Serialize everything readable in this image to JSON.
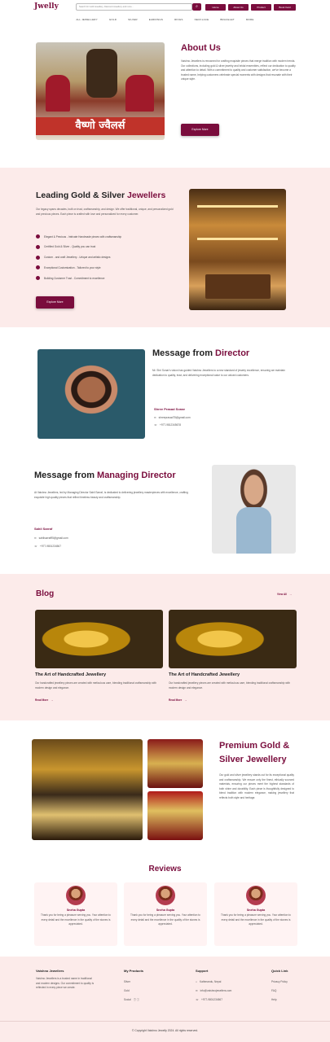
{
  "header": {
    "logo": "Jwelly",
    "search_placeholder": "Search for Gold Jewellery, Diamond Jewellery and more...",
    "nav": [
      "Home",
      "About Us",
      "Product",
      "Book Card"
    ]
  },
  "categories": [
    "ALL JEWELLERY",
    "GOLD",
    "SILVER",
    "EARRINGS",
    "RINGS",
    "NECKLACE",
    "BRACELET",
    "MORE"
  ],
  "about": {
    "title": "About Us",
    "text": "Vaishno Jewellers is renowned for crafting exquisite pieces that merge tradition with modern trends. Our collections, including gold & silver jewelry and bridal ensembles, reflect our dedication to quality and attention to detail. With a commitment to quality and customer satisfaction, we've become a trusted name, helping customers celebrate special moments with designs that resonate with their unique style.",
    "button": "Explore More",
    "shop_sign": "वैष्णो ज्वैलर्स"
  },
  "leading": {
    "title_plain": "Leading Gold & Silver ",
    "title_accent": "Jewellers",
    "text": "Our legacy spans decades, built on trust, craftsmanship, and design. We offer traditional, unique, and personalized gold and precious pieces. Each piece is crafted with love and personalized for every customer.",
    "features": [
      "Elegant & Precious - Intricate Handmade pieces with craftsmanship",
      "Certified Gold & Silver - Quality you can trust",
      "Custom - and craft Jewellery - Unique and artistic designs",
      "Exceptional Customization - Tailored to your style",
      "Building Customer Trust - Commitment to excellence"
    ],
    "button": "Explore More"
  },
  "director": {
    "title_plain": "Message from ",
    "title_accent": "Director",
    "text": "Mr. Shri Sonar's vision has guided Vaishno Jewellers to a new standard of jewelry excellence, ensuring we maintain dedication to quality, trust, and delivering exceptional value to our valued customers.",
    "name": "Shree Prasad Sonar",
    "email": "shreeprasad75@gmail.com",
    "phone": "+977-9812345678"
  },
  "md": {
    "title_plain": "Message from ",
    "title_accent": "Managing Director",
    "text": "At Vaishno Jewellers, led by Managing Director Sahil Sarraf, is dedicated to delivering jewellery masterpieces with excellence, crafting exquisite high quality pieces that reflect timeless beauty and craftsmanship.",
    "name": "Sahil Sarraf",
    "email": "sahilsarraf95@gmail.com",
    "phone": "+977-9801234567"
  },
  "blog": {
    "title": "Blog",
    "view_all": "View All",
    "posts": [
      {
        "title": "The Art of Handcrafted Jewellery",
        "text": "Our handcrafted jewellery pieces are created with meticulous care, blending traditional craftsmanship with modern design and elegance.",
        "link": "Read More"
      },
      {
        "title": "The Art of Handcrafted Jewellery",
        "text": "Our handcrafted jewellery pieces are created with meticulous care, blending traditional craftsmanship with modern design and elegance.",
        "link": "Read More"
      }
    ]
  },
  "premium": {
    "title": "Premium Gold & Silver Jewellery",
    "text": "Our gold and silver jewellery stands out for its exceptional quality and craftsmanship. We ensure only the finest, ethically sourced materials, ensuring our pieces meet the highest standards of both shine and durability. Each piece is thoughtfully designed to blend tradition with modern elegance, making jewellery that reflects both style and heritage."
  },
  "reviews": {
    "title": "Reviews",
    "items": [
      {
        "name": "Sneha Gupta",
        "text": "Thank you for being a pleasure serving you. Your attention to every detail and the excellence in the quality of the stones is appreciated."
      },
      {
        "name": "Sneha Gupta",
        "text": "Thank you for being a pleasure serving you. Your attention to every detail and the excellence in the quality of the stones is appreciated."
      },
      {
        "name": "Sneha Gupta",
        "text": "Thank you for being a pleasure serving you. Your attention to every detail and the excellence in the quality of the stones is appreciated."
      }
    ]
  },
  "footer": {
    "brand": "Vaishno Jewellers",
    "about": "Vaishno Jewellers is a trusted name in traditional and modern designs. Our commitment to quality is reflected in every piece we create.",
    "products_title": "My Products",
    "products": [
      "Silver",
      "Gold",
      "Social"
    ],
    "support_title": "Support",
    "support": [
      "Kathmandu, Nepal",
      "info@vaishnojewellers.com",
      "+977-9801234567"
    ],
    "quick_title": "Quick Link",
    "quick": [
      "Privacy Policy",
      "FAQ",
      "Help"
    ],
    "copyright": "Copyright Vaishno Jewelly 2024. All rights reserved."
  },
  "colors": {
    "accent": "#7a0d3d",
    "section_bg": "#fcebea"
  }
}
